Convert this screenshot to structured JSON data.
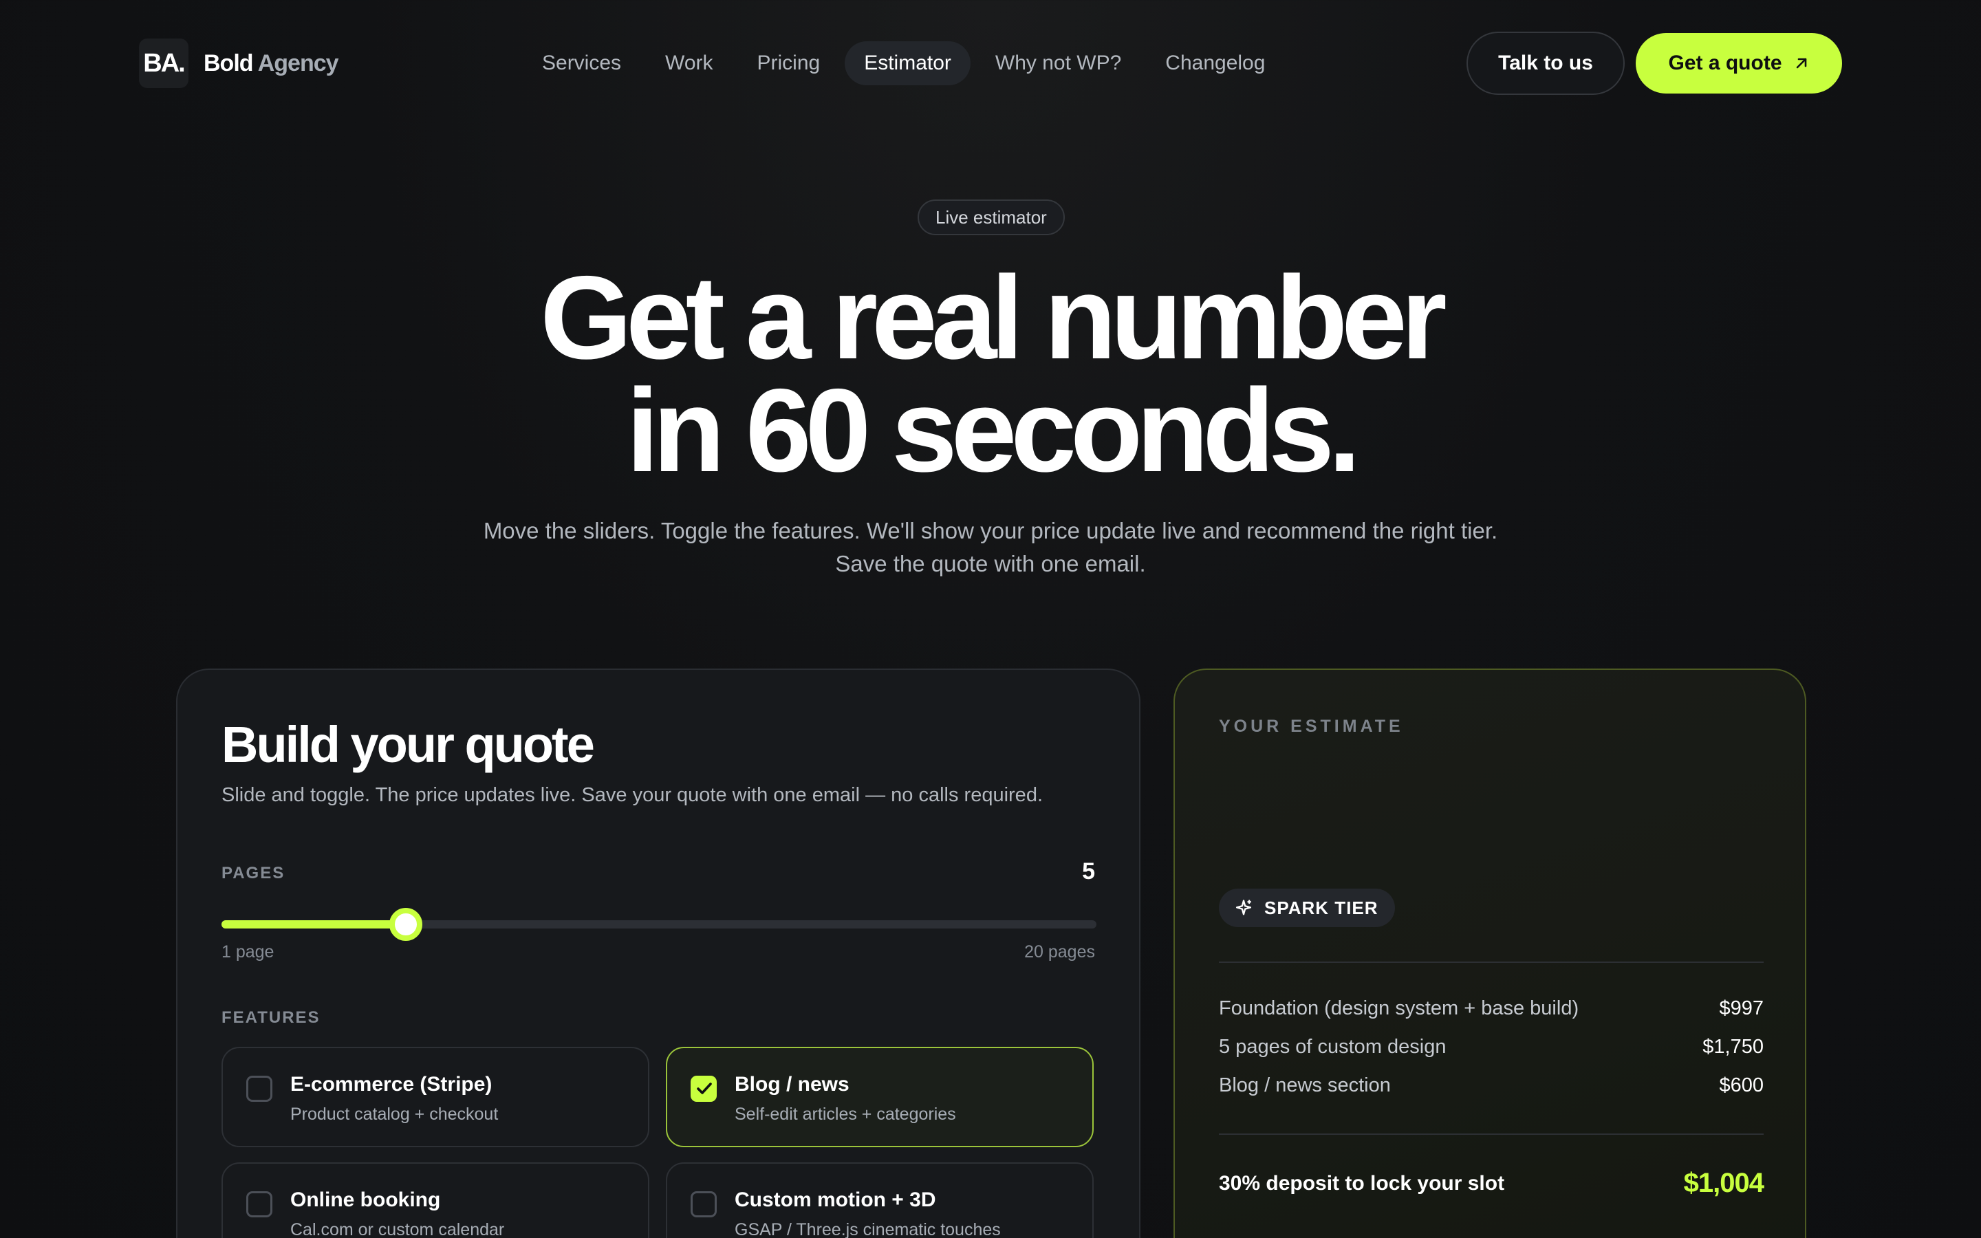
{
  "nav": {
    "logo_mark": "BA.",
    "brand_part1": "Bold",
    "brand_part2": "Agency",
    "links": [
      "Services",
      "Work",
      "Pricing",
      "Estimator",
      "Why not WP?",
      "Changelog"
    ],
    "active_link": "Estimator",
    "talk_label": "Talk to us",
    "quote_label": "Get a quote"
  },
  "hero": {
    "pill": "Live estimator",
    "title_line1": "Get a real number",
    "title_line2": "in 60 seconds.",
    "sub_line1": "Move the sliders. Toggle the features. We'll show your price update live and recommend the right tier.",
    "sub_line2": "Save the quote with one email."
  },
  "builder": {
    "title": "Build your quote",
    "subtitle": "Slide and toggle. The price updates live. Save your quote with one email — no calls required.",
    "pages_label": "PAGES",
    "pages_value": "5",
    "pages_min": 1,
    "pages_max": 20,
    "range_min_label": "1 page",
    "range_max_label": "20 pages",
    "features_label": "FEATURES",
    "features": [
      {
        "title": "E-commerce (Stripe)",
        "desc": "Product catalog + checkout",
        "checked": false
      },
      {
        "title": "Blog / news",
        "desc": "Self-edit articles + categories",
        "checked": true
      },
      {
        "title": "Online booking",
        "desc": "Cal.com or custom calendar",
        "checked": false
      },
      {
        "title": "Custom motion + 3D",
        "desc": "GSAP / Three.js cinematic touches",
        "checked": false
      }
    ]
  },
  "estimate": {
    "heading": "YOUR ESTIMATE",
    "tier": "SPARK TIER",
    "items": [
      {
        "label": "Foundation (design system + base build)",
        "amount": "$997"
      },
      {
        "label": "5 pages of custom design",
        "amount": "$1,750"
      },
      {
        "label": "Blog / news section",
        "amount": "$600"
      }
    ],
    "deposit_label": "30% deposit to lock your slot",
    "deposit_value": "$1,004"
  },
  "colors": {
    "accent": "#c8ff3e",
    "background": "#111214",
    "card": "#17191c"
  }
}
